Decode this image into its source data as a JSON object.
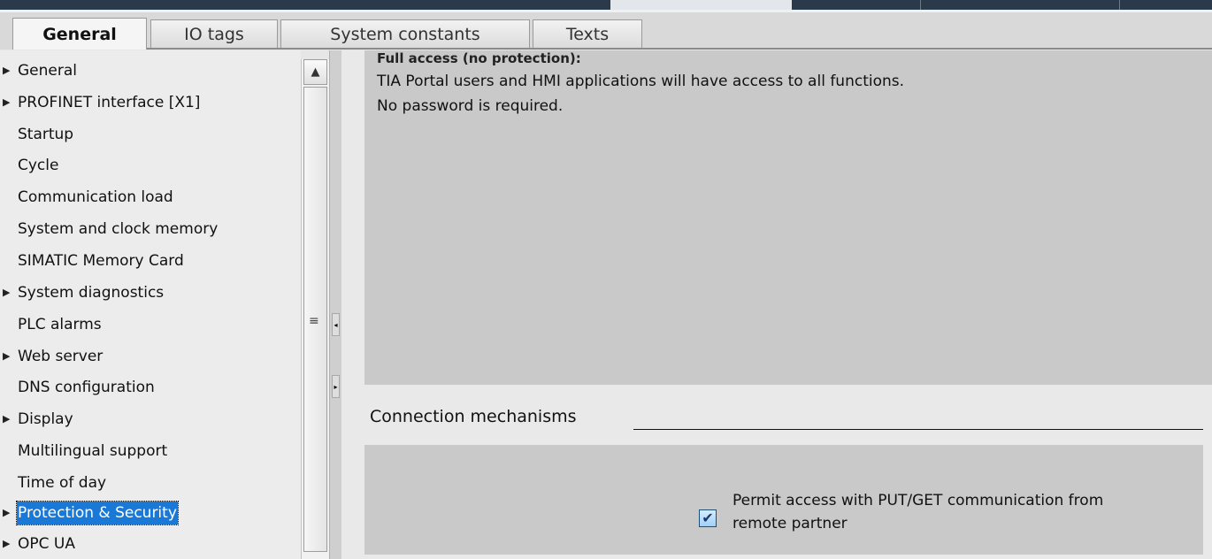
{
  "tabs": [
    {
      "label": "General",
      "active": true
    },
    {
      "label": "IO tags",
      "active": false
    },
    {
      "label": "System constants",
      "active": false
    },
    {
      "label": "Texts",
      "active": false
    }
  ],
  "nav": {
    "items": [
      {
        "label": "General",
        "expandable": true,
        "selected": false
      },
      {
        "label": "PROFINET interface [X1]",
        "expandable": true,
        "selected": false
      },
      {
        "label": "Startup",
        "expandable": false,
        "selected": false
      },
      {
        "label": "Cycle",
        "expandable": false,
        "selected": false
      },
      {
        "label": "Communication load",
        "expandable": false,
        "selected": false
      },
      {
        "label": "System and clock memory",
        "expandable": false,
        "selected": false
      },
      {
        "label": "SIMATIC Memory Card",
        "expandable": false,
        "selected": false
      },
      {
        "label": "System diagnostics",
        "expandable": true,
        "selected": false
      },
      {
        "label": "PLC alarms",
        "expandable": false,
        "selected": false
      },
      {
        "label": "Web server",
        "expandable": true,
        "selected": false
      },
      {
        "label": "DNS configuration",
        "expandable": false,
        "selected": false
      },
      {
        "label": "Display",
        "expandable": true,
        "selected": false
      },
      {
        "label": "Multilingual support",
        "expandable": false,
        "selected": false
      },
      {
        "label": "Time of day",
        "expandable": false,
        "selected": false
      },
      {
        "label": "Protection & Security",
        "expandable": true,
        "selected": true
      },
      {
        "label": "OPC UA",
        "expandable": true,
        "selected": false
      }
    ],
    "scroll_up_icon": "▲",
    "grip_icon": "≡"
  },
  "splitter": {
    "collapse_left_icon": "◂",
    "expand_right_icon": "▸"
  },
  "access_level": {
    "title": "Full access (no protection):",
    "line1": "TIA Portal users and HMI applications will have access to all functions.",
    "line2": "No password is required."
  },
  "connection": {
    "section_title": "Connection mechanisms",
    "putget_label_line1": "Permit access with PUT/GET communication from",
    "putget_label_line2": "remote partner",
    "putget_checked": true,
    "check_icon": "✔"
  },
  "colors": {
    "selection": "#1a78d6",
    "panel": "#c9c9c9",
    "header_dark": "#2b3a4a"
  }
}
